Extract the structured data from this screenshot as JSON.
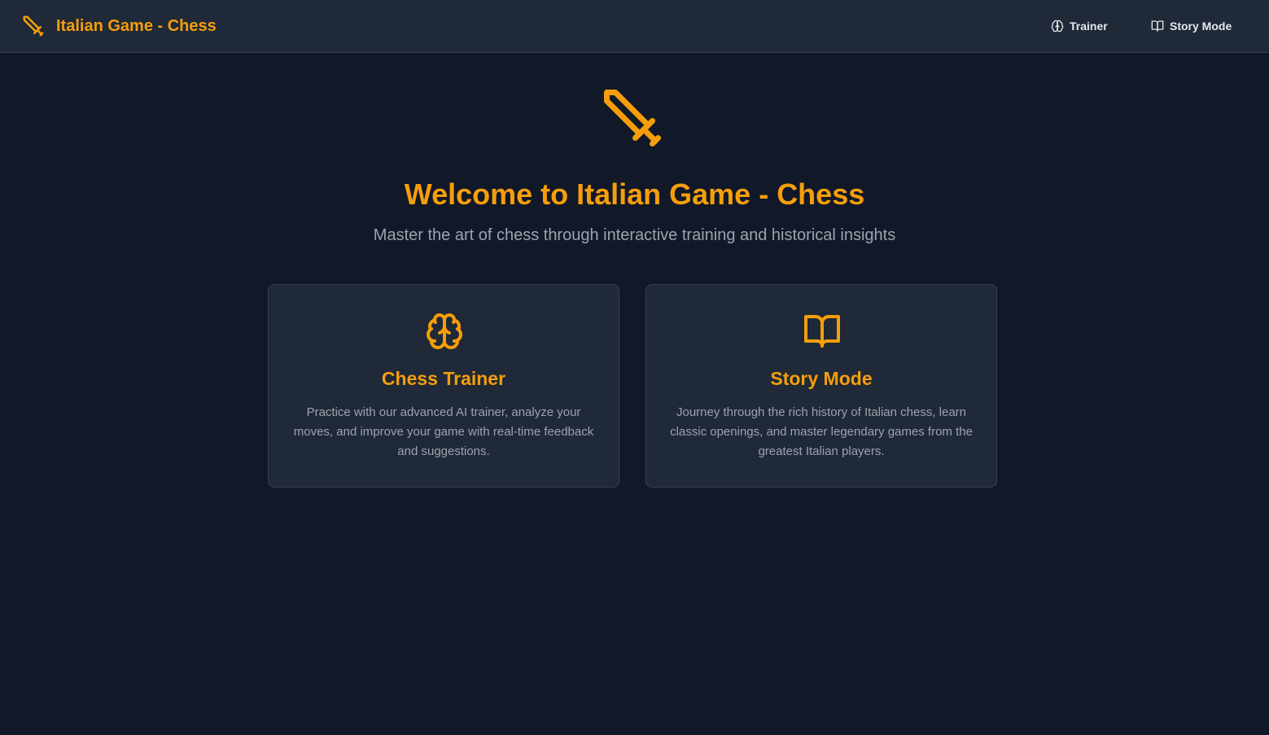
{
  "app": {
    "brand_name": "Italian Game - Chess",
    "brand_icon": "sword-icon",
    "accent_color": "#f59e0b",
    "background_color": "#111827",
    "panel_color": "#1f2937"
  },
  "nav": {
    "items": [
      {
        "label": "Trainer",
        "icon": "brain-icon"
      },
      {
        "label": "Story Mode",
        "icon": "book-open-icon"
      }
    ]
  },
  "hero": {
    "icon": "sword-icon",
    "title": "Welcome to Italian Game - Chess",
    "subtitle": "Master the art of chess through interactive training and historical insights"
  },
  "cards": [
    {
      "icon": "brain-icon",
      "title": "Chess Trainer",
      "description": "Practice with our advanced AI trainer, analyze your moves, and improve your game with real-time feedback and suggestions."
    },
    {
      "icon": "book-open-icon",
      "title": "Story Mode",
      "description": "Journey through the rich history of Italian chess, learn classic openings, and master legendary games from the greatest Italian players."
    }
  ]
}
